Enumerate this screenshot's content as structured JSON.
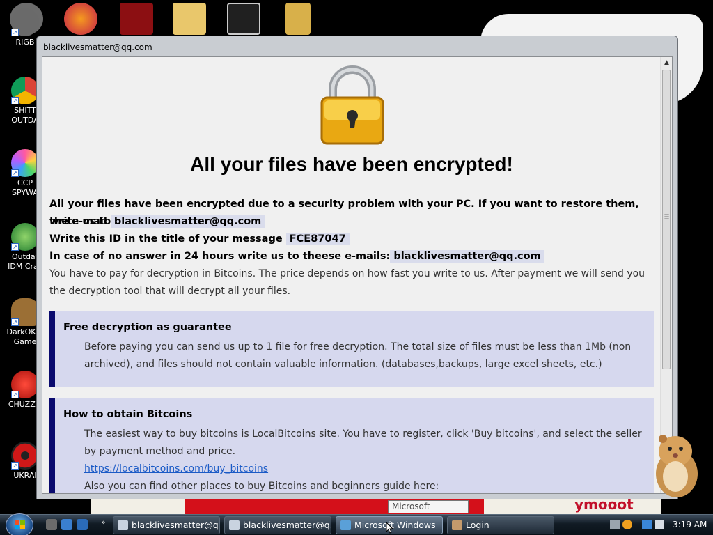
{
  "desktop": {
    "icons": [
      {
        "label": "RIGB",
        "icon": "raccoon-icon",
        "color": "#5a5a5a"
      },
      {
        "label": "SHITT OUTDA",
        "icon": "chrome-icon",
        "color": "#3b8ee8"
      },
      {
        "label": "CCP SPYWA",
        "icon": "colorful-logo-icon",
        "color": "#e86a9a"
      },
      {
        "label": "Outdat IDM Crac",
        "icon": "idm-icon",
        "color": "#2e8b3e"
      },
      {
        "label": "DarkOK V Game",
        "icon": "money-bag-icon",
        "color": "#a97a3a"
      },
      {
        "label": "CHUZZLI",
        "icon": "chuzzle-icon",
        "color": "#d91b1b"
      },
      {
        "label": "UKRAI",
        "icon": "radiation-icon",
        "color": "#c41818"
      }
    ],
    "wall_graffiti": "ymooot"
  },
  "window": {
    "title": "blacklivesmatter@qq.com",
    "headline": "All your files have been encrypted!",
    "intro_line1": "All your files have been encrypted due to a security problem with your PC. If you want to restore them, write us to",
    "intro_line2_prefix": "the e-mail",
    "email": "blacklivesmatter@qq.com",
    "id_prefix": "Write this ID in the title of your message",
    "id_value": "FCE87047",
    "backup_prefix": "In case of no answer in 24 hours write us to theese e-mails:",
    "backup_email": "blacklivesmatter@qq.com",
    "pay_text": "You have to pay for decryption in Bitcoins. The price depends on how fast you write to us. After payment we will send you the decryption tool that will decrypt all your files.",
    "box1_title": "Free decryption as guarantee",
    "box1_text": "Before paying you can send us up to 1 file for free decryption. The total size of files must be less than 1Mb (non archived), and files should not contain valuable information. (databases,backups, large excel sheets, etc.)",
    "box2_title": "How to obtain Bitcoins",
    "box2_text": "The easiest way to buy bitcoins is LocalBitcoins site. You have to register, click 'Buy bitcoins', and select the seller by payment method and price.",
    "box2_link": "https://localbitcoins.com/buy_bitcoins",
    "box2_more": "Also you can find other places to buy Bitcoins and beginners guide here:"
  },
  "tooltip": "Microsoft Windows",
  "taskbar": {
    "more_glyph": "»",
    "buttons": [
      {
        "label": "blacklivesmatter@q...",
        "icon": "window-app-icon"
      },
      {
        "label": "blacklivesmatter@q...",
        "icon": "window-app-icon"
      },
      {
        "label": "Microsoft Windows",
        "icon": "windows-app-icon"
      },
      {
        "label": "Login",
        "icon": "login-app-icon"
      }
    ],
    "clock": "3:19 AM"
  }
}
